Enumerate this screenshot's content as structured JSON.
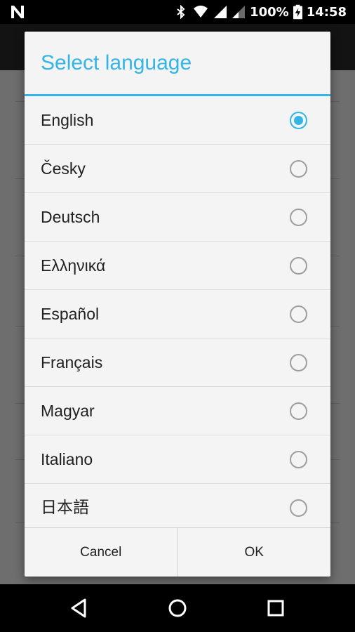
{
  "status_bar": {
    "battery_text": "100%",
    "time": "14:58",
    "icons": [
      "n-notification-icon",
      "bluetooth-icon",
      "wifi-icon",
      "signal-icon",
      "signal-weak-icon",
      "battery-charging-icon"
    ]
  },
  "dialog": {
    "title": "Select language",
    "selected": "English",
    "languages": [
      {
        "label": "English",
        "checked": true
      },
      {
        "label": "Česky",
        "checked": false
      },
      {
        "label": "Deutsch",
        "checked": false
      },
      {
        "label": "Ελληνικά",
        "checked": false
      },
      {
        "label": "Español",
        "checked": false
      },
      {
        "label": "Français",
        "checked": false
      },
      {
        "label": "Magyar",
        "checked": false
      },
      {
        "label": "Italiano",
        "checked": false
      },
      {
        "label": "日本語",
        "checked": false
      }
    ],
    "cancel_label": "Cancel",
    "ok_label": "OK"
  },
  "colors": {
    "accent": "#33b5e5",
    "dialog_bg": "#f4f4f4"
  },
  "nav_bar": {
    "icons": [
      "back-icon",
      "home-icon",
      "recents-icon"
    ]
  }
}
